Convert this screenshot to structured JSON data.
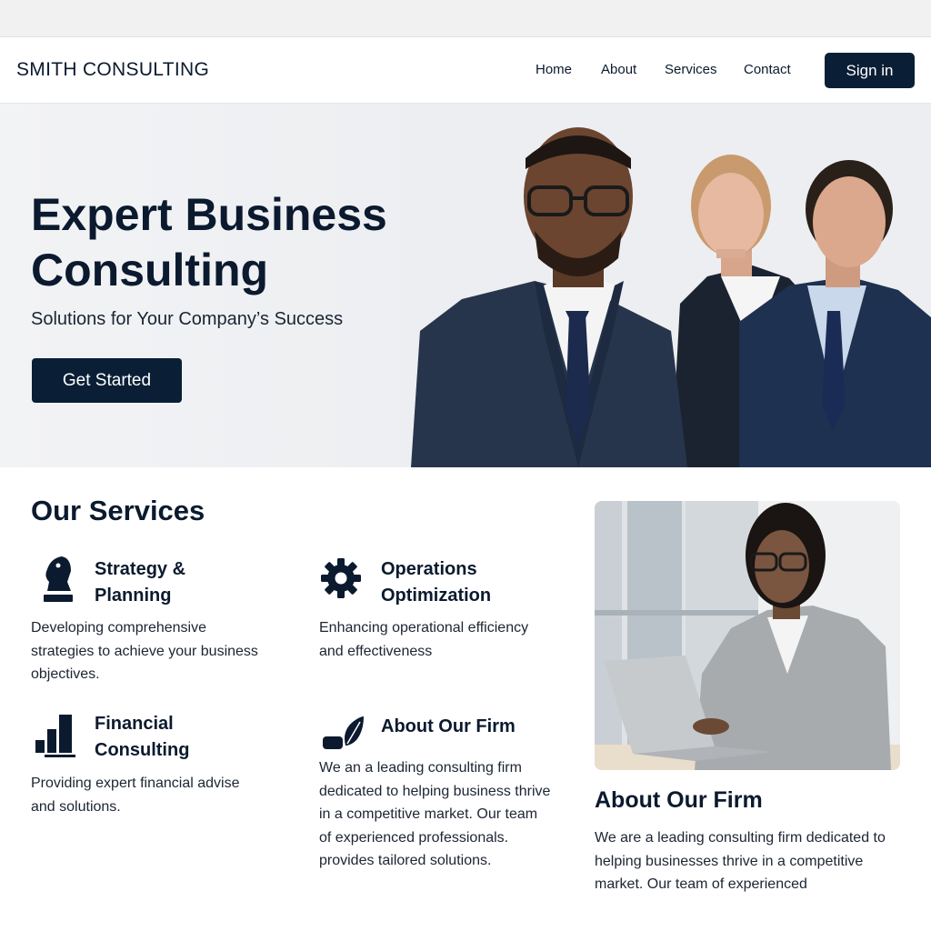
{
  "brand": {
    "name": "SMITH CONSULTING"
  },
  "nav": {
    "links": [
      "Home",
      "About",
      "Services",
      "Contact"
    ],
    "signin_label": "Sign in"
  },
  "hero": {
    "title_line1": "Expert Business",
    "title_line2": "Consulting",
    "subtitle": "Solutions for Your Company’s Success",
    "cta_label": "Get Started"
  },
  "services": {
    "heading": "Our Services",
    "items": [
      {
        "icon": "chess-knight-icon",
        "title_line1": "Strategy &",
        "title_line2": "Planning",
        "desc_lines": [
          "Developing comprehensive",
          "strategies to achieve your business",
          "objectives."
        ]
      },
      {
        "icon": "gear-icon",
        "title_line1": "Operations",
        "title_line2": "Optimization",
        "desc_lines": [
          "Enhancing operational efficiency",
          "and effectiveness"
        ]
      },
      {
        "icon": "bar-chart-icon",
        "title_line1": "Financial",
        "title_line2": "Consulting",
        "desc_lines": [
          "Providing expert financial advise",
          "and solutions."
        ]
      },
      {
        "icon": "handshake-leaf-icon",
        "title_line1": "About Our Firm",
        "title_line2": "",
        "desc_lines": [
          "We an a leading consulting firm",
          "dedicated to helping business thrive",
          "in a competitive market. Our team",
          "of experienced professionals.",
          "provides tailored solutions."
        ]
      }
    ]
  },
  "about": {
    "heading": "About Our Firm",
    "text_lines": [
      "We are a leading consulting firm dedicated to",
      "helping businesses thrive in a competitive",
      "market. Our team of experienced"
    ]
  },
  "colors": {
    "primary": "#0a1f36",
    "text": "#0b1a2e",
    "hero_bg": "#eceef1"
  }
}
